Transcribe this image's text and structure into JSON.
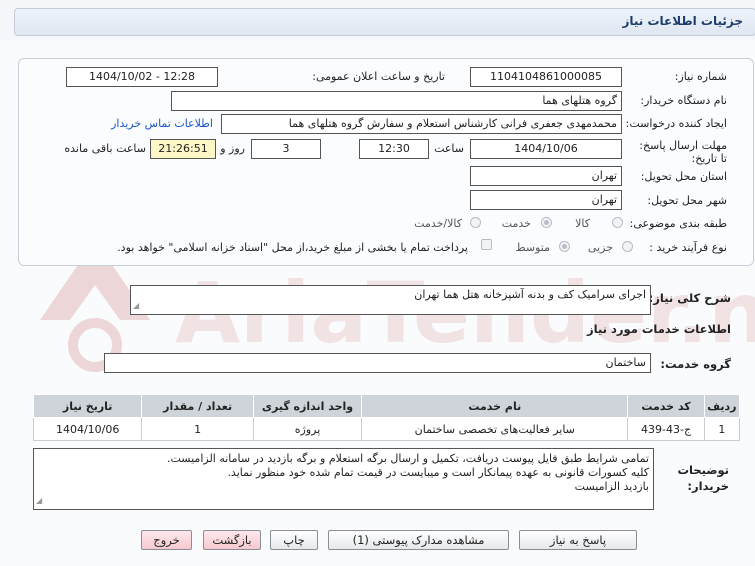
{
  "header": {
    "title": "جزئیات اطلاعات نیاز"
  },
  "form": {
    "need_number_label": "شماره نیاز:",
    "need_number": "1104104861000085",
    "announce_label": "تاریخ و ساعت اعلان عمومی:",
    "announce_value": "1404/10/02 - 12:28",
    "buyer_org_label": "نام دستگاه خریدار:",
    "buyer_org": "گروه هتلهای هما",
    "creator_label": "ایجاد کننده درخواست:",
    "creator": "محمدمهدی جعفری فرانی کارشناس استعلام و سفارش گروه هتلهای هما",
    "contact_link": "اطلاعات تماس خریدار",
    "deadline_label": "مهلت ارسال پاسخ: تا تاریخ:",
    "deadline_date": "1404/10/06",
    "time_label": "ساعت",
    "deadline_time": "12:30",
    "days_value": "3",
    "days_label": "روز و",
    "remaining_time": "21:26:51",
    "remaining_label": "ساعت باقی مانده",
    "province_label": "استان محل تحویل:",
    "province": "تهران",
    "city_label": "شهر محل تحویل:",
    "city": "تهران",
    "category_label": "طبقه بندی موضوعی:",
    "category_options": [
      "کالا",
      "خدمت",
      "کالا/خدمت"
    ],
    "category_selected": "خدمت",
    "process_label": "نوع فرآیند خرید :",
    "process_options": [
      "جزیی",
      "متوسط"
    ],
    "process_selected": "متوسط",
    "payment_note": "پرداخت تمام یا بخشی از مبلغ خرید،از محل \"اسناد خزانه اسلامی\" خواهد بود."
  },
  "description": {
    "label": "شرح کلی نیاز:",
    "value": "اجرای سرامیک کف و بدنه آشپزخانه هتل هما تهران"
  },
  "services": {
    "section_title": "اطلاعات خدمات مورد نیاز",
    "group_label": "گروه خدمت:",
    "group_value": "ساختمان",
    "columns": [
      "ردیف",
      "کد خدمت",
      "نام خدمت",
      "واحد اندازه گیری",
      "تعداد / مقدار",
      "تاریخ نیاز"
    ],
    "rows": [
      [
        "1",
        "ج-43-439",
        "سایر فعالیت‌های تخصصی ساختمان",
        "پروژه",
        "1",
        "1404/10/06"
      ]
    ]
  },
  "buyer_notes": {
    "label_line1": "توضیحات",
    "label_line2": "خریدار:",
    "lines": [
      "تمامی شرایط طبق فایل پیوست دریافت، تکمیل و ارسال برگه استعلام و برگه بازدید در سامانه الزامیست.",
      "کلیه کسورات قانونی به عهده پیمانکار است و میبایست در قیمت تمام شده خود منظور نماید.",
      "بازدید الزامیست"
    ]
  },
  "buttons": {
    "reply": "پاسخ به نیاز",
    "attachments": "مشاهده مدارک پیوستی (1)",
    "print": "چاپ",
    "back": "بازگشت",
    "exit": "خروج"
  },
  "watermark": {
    "text": "AriaTender.neT"
  },
  "colors": {
    "accent_link": "#1a56c8",
    "header_text": "#1d3d6b",
    "remaining_bg": "#fdf6c7",
    "table_header_bg": "#cfd4da",
    "watermark": "#e8c9c9"
  }
}
